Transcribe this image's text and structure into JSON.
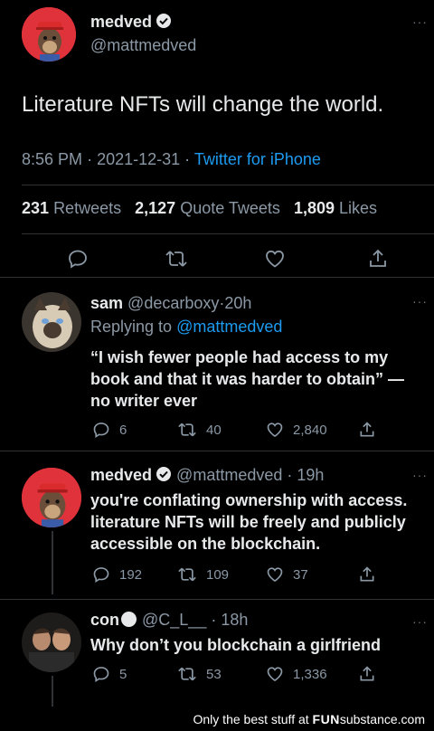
{
  "main_tweet": {
    "name": "medved",
    "handle": "@mattmedved",
    "text": "Literature NFTs will change the world.",
    "time": "8:56 PM",
    "date": "2021-12-31",
    "source": "Twitter for iPhone",
    "retweets": "231",
    "retweets_label": "Retweets",
    "quotes": "2,127",
    "quotes_label": "Quote Tweets",
    "likes": "1,809",
    "likes_label": "Likes"
  },
  "replies": [
    {
      "name": "sam",
      "handle": "@decarboxy",
      "age": "20h",
      "replying_to_label": "Replying to",
      "replying_to": "@mattmedved",
      "lines": [
        "“I wish fewer people had access to my",
        "book and that it was harder to obtain” —",
        "no writer ever"
      ],
      "replies": "6",
      "retweets": "40",
      "likes": "2,840"
    },
    {
      "name": "medved",
      "handle": "@mattmedved",
      "age": "19h",
      "lines": [
        "you're conflating ownership with access.",
        "literature NFTs will be freely and publicly",
        "accessible on the blockchain."
      ],
      "replies": "192",
      "retweets": "109",
      "likes": "37"
    },
    {
      "name": "con",
      "handle": "@C_L__",
      "age": "18h",
      "lines": [
        "Why don’t you blockchain a girlfriend"
      ],
      "replies": "5",
      "retweets": "53",
      "likes": "1,336"
    }
  ],
  "footer": {
    "prefix": "Only the best stuff at",
    "brand": "FUN",
    "brand2": "substance",
    "suffix": ".com"
  },
  "icons": {
    "reply": "reply-icon",
    "retweet": "retweet-icon",
    "like": "heart-icon",
    "share": "share-icon",
    "verified": "verified-badge-icon",
    "more": "more-options-icon"
  },
  "colors": {
    "background": "#000000",
    "text": "#e7e9ea",
    "secondary": "#8b98a5",
    "link": "#1d9bf0",
    "divider": "#2f3336"
  }
}
